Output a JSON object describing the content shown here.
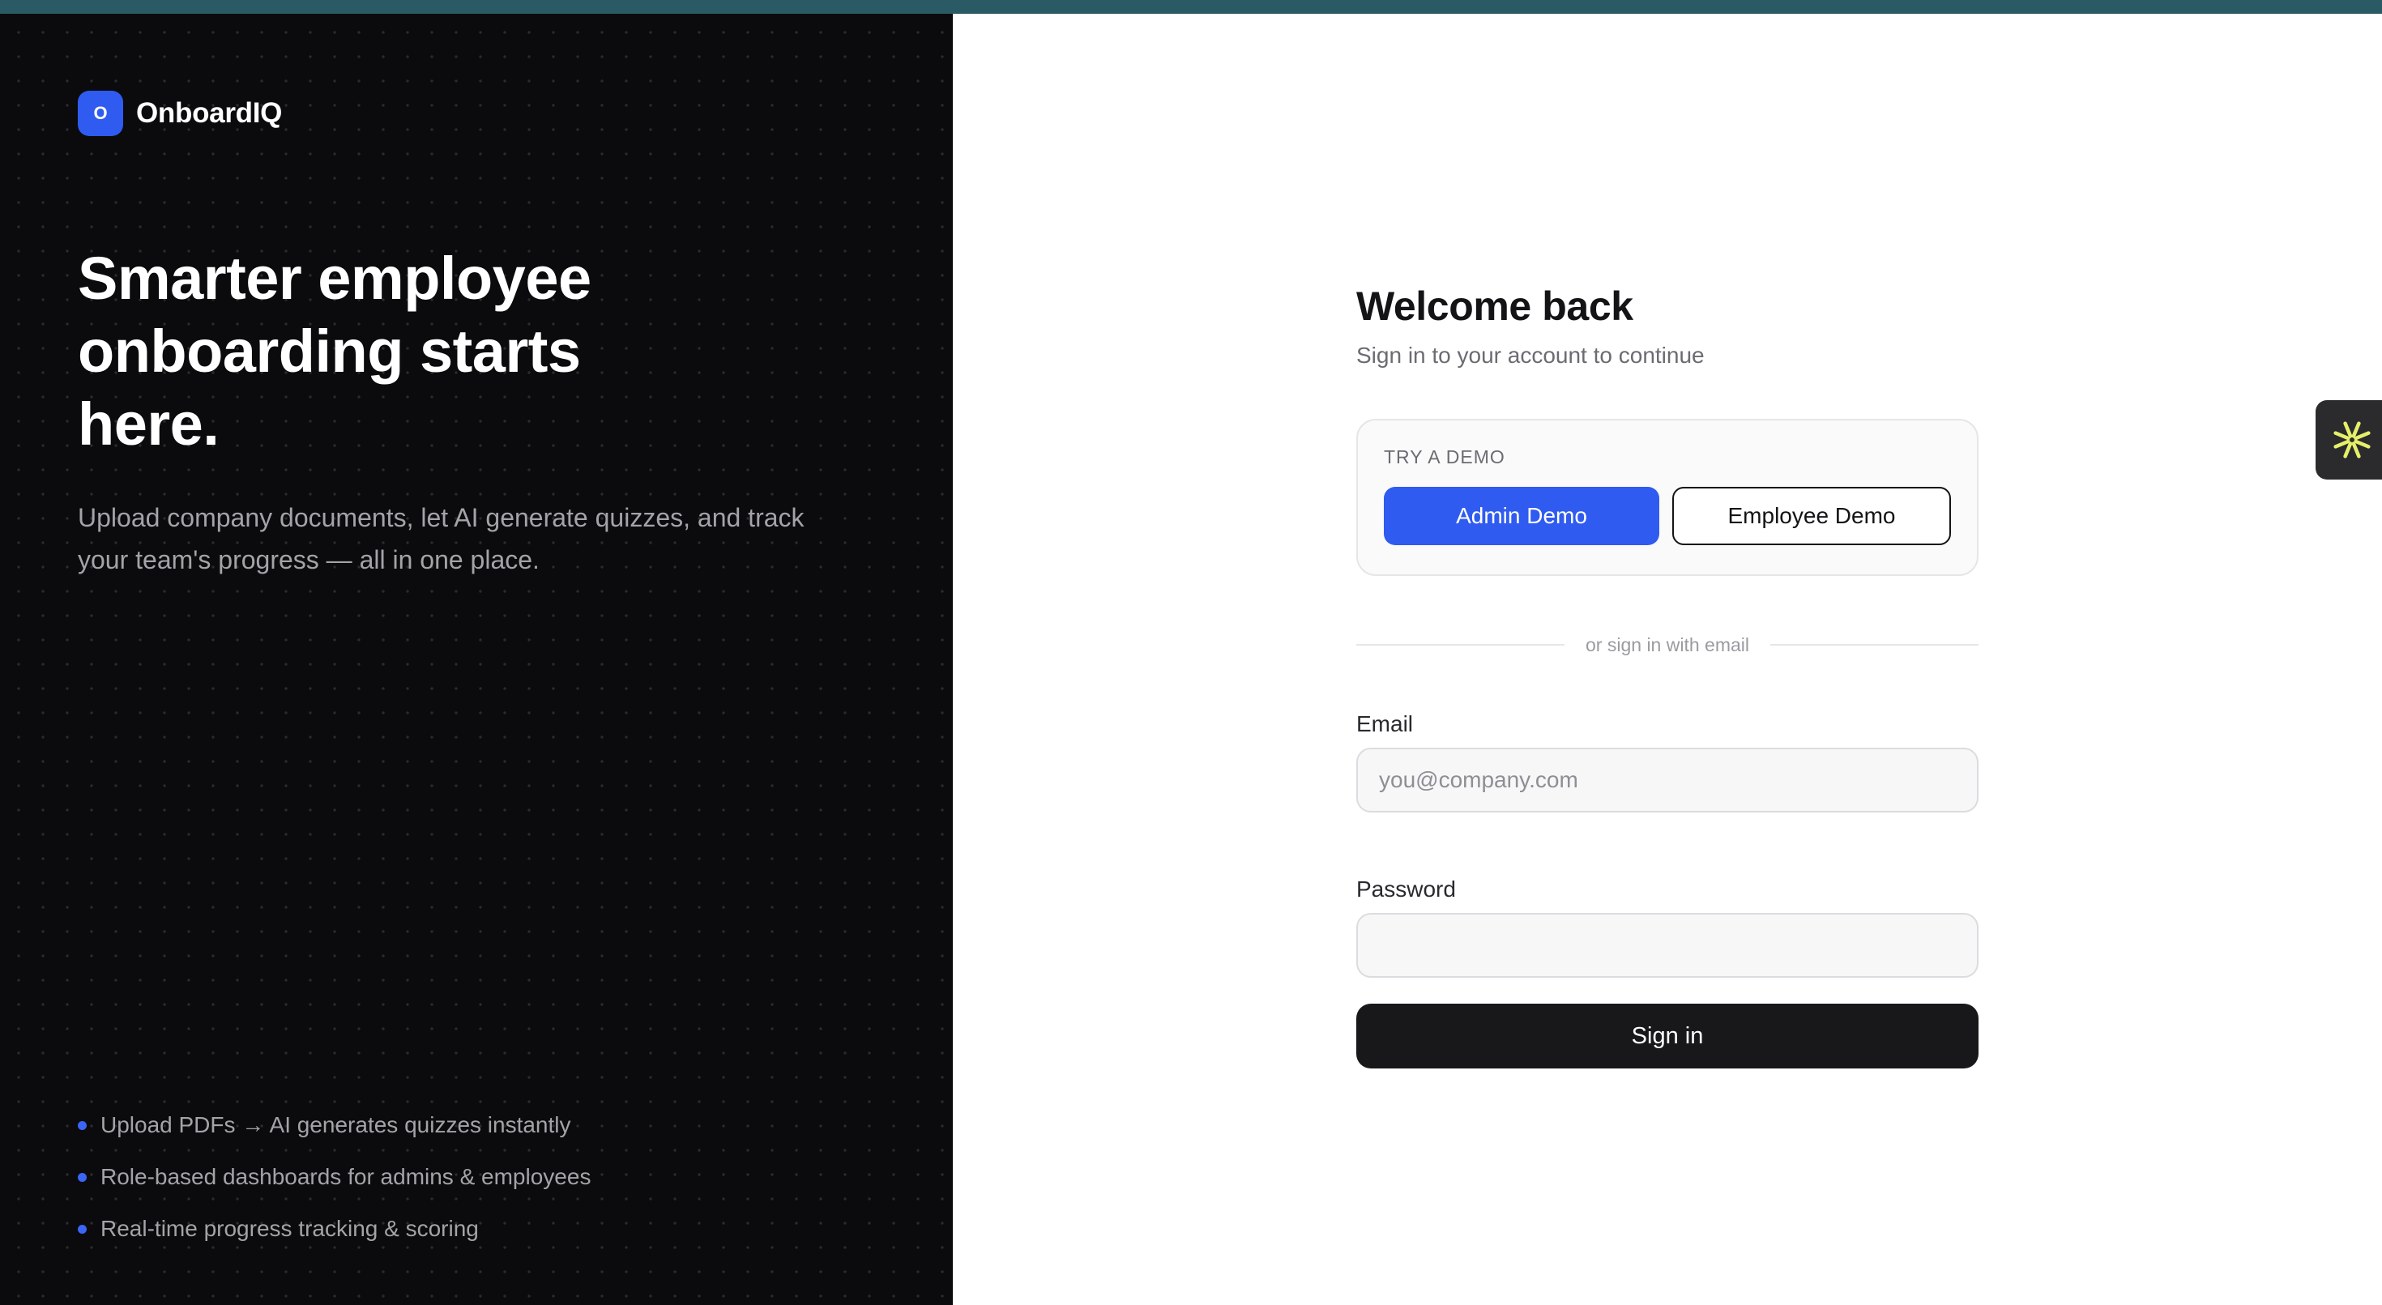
{
  "brand": {
    "logo_letter": "O",
    "name": "OnboardIQ",
    "accent_color": "#2f5bf0"
  },
  "hero": {
    "title": "Smarter employee onboarding starts here.",
    "subtitle": "Upload company documents, let AI generate quizzes, and track your team's progress — all in one place."
  },
  "features": [
    {
      "text": "Upload PDFs → AI generates quizzes instantly",
      "bullet_icon": "bullet-dot-icon"
    },
    {
      "text": "Role-based dashboards for admins & employees",
      "bullet_icon": "bullet-dot-icon"
    },
    {
      "text": "Real-time progress tracking & scoring",
      "bullet_icon": "bullet-dot-icon"
    }
  ],
  "login": {
    "title": "Welcome back",
    "subtitle": "Sign in to your account to continue",
    "demo": {
      "label": "TRY A DEMO",
      "admin_button": "Admin Demo",
      "employee_button": "Employee Demo"
    },
    "divider_text": "or sign in with email",
    "email": {
      "label": "Email",
      "placeholder": "you@company.com",
      "value": ""
    },
    "password": {
      "label": "Password",
      "placeholder": "",
      "value": ""
    },
    "submit_label": "Sign in"
  },
  "side_widget": {
    "icon": "sparkle-icon",
    "icon_color": "#e5f06a"
  },
  "colors": {
    "topbar": "#2a5a63",
    "left_panel_bg": "#0b0b0d",
    "primary_button": "#2f5bf0",
    "signin_button": "#18181b"
  }
}
